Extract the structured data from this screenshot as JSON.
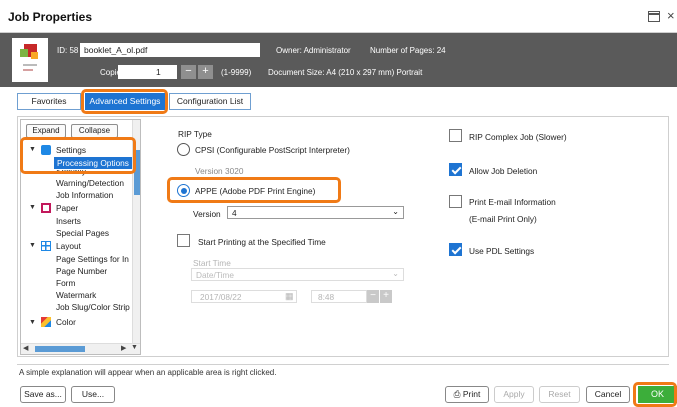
{
  "window": {
    "title": "Job Properties",
    "maximize_icon": "maximize-icon",
    "close_glyph": "×"
  },
  "job": {
    "id_label": "ID: 58",
    "filename": "booklet_A_ol.pdf",
    "owner": "Owner:  Administrator",
    "pages": "Number of Pages:  24",
    "copies_label": "Copies",
    "copies_value": "1",
    "copies_minus": "−",
    "copies_plus": "+",
    "copies_range": "(1-9999)",
    "doc_size": "Document Size:  A4 (210 x 297 mm) Portrait"
  },
  "tabs": [
    {
      "label": "Favorites"
    },
    {
      "label": "Advanced Settings",
      "active": true
    },
    {
      "label": "Configuration List"
    }
  ],
  "tree": {
    "expand": "Expand",
    "collapse": "Collapse",
    "items": [
      {
        "label": "Settings",
        "icon": "settings-icon"
      },
      {
        "label": "Processing Options",
        "selected": true
      },
      {
        "label": "Security"
      },
      {
        "label": "Warning/Detection"
      },
      {
        "label": "Job Information"
      },
      {
        "label": "Paper",
        "icon": "paper-icon"
      },
      {
        "label": "Inserts"
      },
      {
        "label": "Special Pages"
      },
      {
        "label": "Layout",
        "icon": "layout-icon"
      },
      {
        "label": "Page Settings for In"
      },
      {
        "label": "Page Number"
      },
      {
        "label": "Form"
      },
      {
        "label": "Watermark"
      },
      {
        "label": "Job Slug/Color Strip"
      },
      {
        "label": "Color",
        "icon": "color-icon"
      }
    ]
  },
  "rip": {
    "heading": "RIP Type",
    "cpsi_label": "CPSI (Configurable PostScript Interpreter)",
    "cpsi_version": "Version   3020",
    "appe_label": "APPE (Adobe PDF Print Engine)",
    "version_label": "Version",
    "version_value": "4",
    "start_printing_label": "Start Printing at the Specified Time",
    "start_time_label": "Start Time",
    "start_time_select": "Date/Time",
    "date_value": "2017/08/22",
    "time_value": "8:48",
    "time_minus": "−",
    "time_plus": "+"
  },
  "options": {
    "rip_complex": "RIP Complex Job (Slower)",
    "allow_deletion": "Allow Job Deletion",
    "print_email": "Print E-mail Information",
    "email_only": "(E-mail Print Only)",
    "use_pdl": "Use PDL Settings"
  },
  "status_text": "A simple explanation will appear when an applicable area is right clicked.",
  "footer": {
    "save_as": "Save as...",
    "use": "Use...",
    "print": "Print",
    "apply": "Apply",
    "reset": "Reset",
    "cancel": "Cancel",
    "ok": "OK"
  },
  "colors": {
    "accent": "#1e74d2",
    "highlight": "#f07a16",
    "ok": "#3cae3a",
    "header_bg": "#5a5a5a"
  }
}
